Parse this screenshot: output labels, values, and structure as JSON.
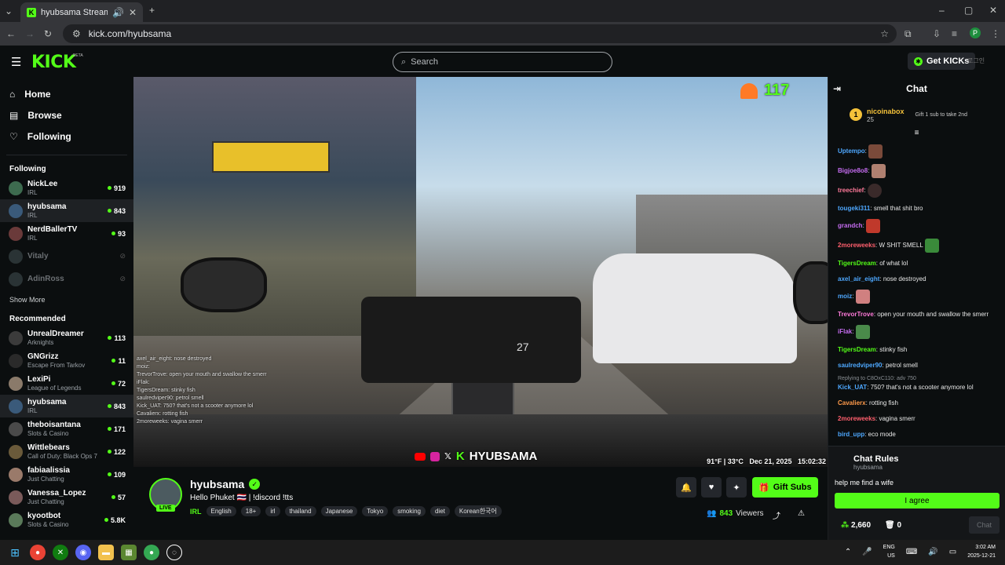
{
  "browser": {
    "tab_title": "hyubsama Stream - Watch l",
    "url": "kick.com/hyubsama",
    "profile_initial": "P"
  },
  "kick": {
    "logo": "KICK",
    "beta": "BETA",
    "search_placeholder": "Search",
    "get_kicks": "Get KICKs",
    "lang_icon": "language-icon"
  },
  "sidebar": {
    "nav": [
      {
        "label": "Home",
        "icon": "home-icon"
      },
      {
        "label": "Browse",
        "icon": "browse-icon"
      },
      {
        "label": "Following",
        "icon": "heart-icon"
      }
    ],
    "following_title": "Following",
    "following": [
      {
        "name": "NickLee",
        "category": "IRL",
        "viewers": "919"
      },
      {
        "name": "hyubsama",
        "category": "IRL",
        "viewers": "843"
      },
      {
        "name": "NerdBallerTV",
        "category": "IRL",
        "viewers": "93"
      },
      {
        "name": "Vitaly",
        "category": "",
        "viewers": ""
      },
      {
        "name": "AdinRoss",
        "category": "",
        "viewers": ""
      }
    ],
    "show_more": "Show More",
    "recommended_title": "Recommended",
    "recommended": [
      {
        "name": "UnrealDreamer",
        "category": "Arknights",
        "viewers": "113"
      },
      {
        "name": "GNGrizz",
        "category": "Escape From Tarkov",
        "viewers": "11"
      },
      {
        "name": "LexiPi",
        "category": "League of Legends",
        "viewers": "72"
      },
      {
        "name": "hyubsama",
        "category": "IRL",
        "viewers": "843"
      },
      {
        "name": "theboisantana",
        "category": "Slots & Casino",
        "viewers": "171"
      },
      {
        "name": "Wittlebears",
        "category": "Call of Duty: Black Ops 7",
        "viewers": "122"
      },
      {
        "name": "fabiaalissia",
        "category": "Just Chatting",
        "viewers": "109"
      },
      {
        "name": "Vanessa_Lopez",
        "category": "Just Chatting",
        "viewers": "57"
      },
      {
        "name": "kyootbot",
        "category": "Slots & Casino",
        "viewers": "5.8K"
      }
    ]
  },
  "video": {
    "heart_count": "117",
    "hud_weather": "91°F | 33°C",
    "hud_date": "Dec 21, 2025",
    "hud_time": "15:02:32",
    "watermark": "HYUBSAMA",
    "overlay_chat": [
      "axel_air_eight: nose destroyed",
      "moiz:",
      "TrevorTrove: open your mouth and swallow the smerr",
      "iFlak:",
      "TigersDream: stinky fish",
      "saulredviper90: petrol smell",
      "Kick_UAT: 750? that's not a scooter anymore lol",
      "Cavalierx: rotting fish",
      "2moreweeks: vagina smerr"
    ],
    "speed": "27"
  },
  "stream": {
    "name": "hyubsama",
    "title": "Hello Phuket 🇹🇭 | !discord !tts",
    "live": "LIVE",
    "category": "IRL",
    "tags": [
      "English",
      "18+",
      "irl",
      "thailand",
      "Japanese",
      "Tokyo",
      "smoking",
      "diet",
      "Korean한국어"
    ],
    "gift_subs": "Gift Subs",
    "viewers": "843",
    "viewers_label": "Viewers"
  },
  "chat": {
    "title": "Chat",
    "pinned": {
      "rank": "1",
      "name": "nicoinabox",
      "subs": "25",
      "gift_text": "Gift 1 sub to take 2nd"
    },
    "messages": [
      {
        "user": "Uptempo",
        "color": "#4ea8ff",
        "text": "",
        "emote": true
      },
      {
        "user": "Bigjoe8o8",
        "color": "#c56cf0",
        "text": "",
        "emote": true
      },
      {
        "user": "treechief",
        "color": "#ff7a9a",
        "text": "",
        "emote": true
      },
      {
        "user": "tougeki311",
        "color": "#4ea8ff",
        "text": "smell that shit bro",
        "emote": false
      },
      {
        "user": "grandch",
        "color": "#c56cf0",
        "text": "",
        "emote": true
      },
      {
        "user": "2moreweeks",
        "color": "#ff5f6d",
        "text": "W SHIT SMELL",
        "emote": true
      },
      {
        "user": "TigersDream",
        "color": "#53fc18",
        "text": "of what lol",
        "emote": false
      },
      {
        "user": "axel_air_eight",
        "color": "#4ea8ff",
        "text": "nose destroyed",
        "emote": false
      },
      {
        "user": "moiz",
        "color": "#4ea8ff",
        "text": "",
        "emote": true
      },
      {
        "user": "TrevorTrove",
        "color": "#ff7ad9",
        "text": "open your mouth and swallow the smerr",
        "emote": false
      },
      {
        "user": "iFlak",
        "color": "#c56cf0",
        "text": "",
        "emote": true
      },
      {
        "user": "TigersDream",
        "color": "#53fc18",
        "text": "stinky fish",
        "emote": false
      },
      {
        "user": "saulredviper90",
        "color": "#4ea8ff",
        "text": "petrol smell",
        "emote": false
      },
      {
        "user": "Kick_UAT",
        "color": "#4ea8ff",
        "text": "750? that's not a scooter anymore lol",
        "emote": false,
        "reply": "Replying to C8OxC110: adv 750"
      },
      {
        "user": "Cavalierx",
        "color": "#ff9a4a",
        "text": "rotting fish",
        "emote": false
      },
      {
        "user": "2moreweeks",
        "color": "#ff5f6d",
        "text": "vagina smerr",
        "emote": false
      },
      {
        "user": "bird_upp",
        "color": "#4ea8ff",
        "text": "eco mode",
        "emote": false
      }
    ],
    "rules_title": "Chat Rules",
    "rules_user": "hyubsama",
    "rules_text": "help me find a wife",
    "agree": "I agree",
    "kicks": "2,660",
    "gifts": "0",
    "chat_button": "Chat"
  },
  "taskbar": {
    "lang": "ENG",
    "region": "US",
    "time": "3:02 AM",
    "date": "2025-12-21"
  }
}
